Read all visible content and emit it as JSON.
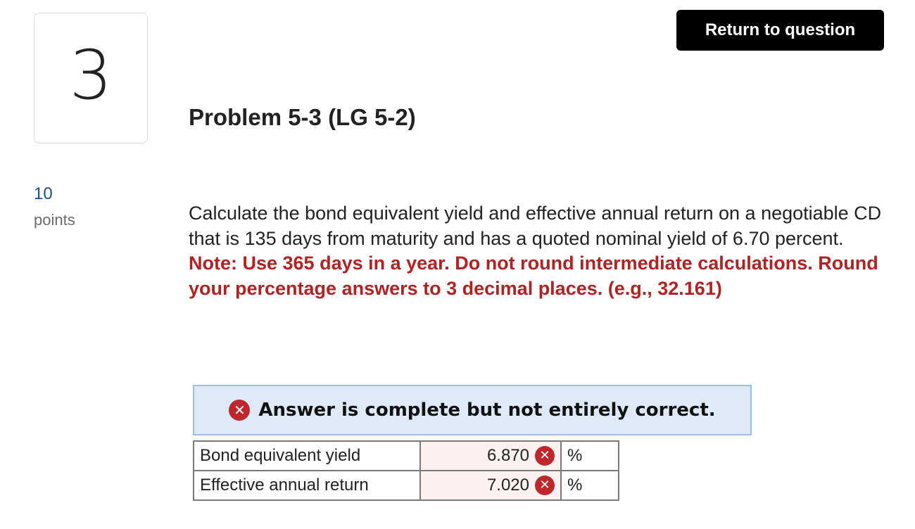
{
  "question": {
    "number": "3",
    "points_value": "10",
    "points_label": "points",
    "title": "Problem 5-3 (LG 5-2)",
    "body": "Calculate the bond equivalent yield and effective annual return on a negotiable CD that is 135 days from maturity and has a quoted nominal yield of 6.70 percent.",
    "note": "Note: Use 365 days in a year. Do not round intermediate calculations. Round your percentage answers to 3 decimal places. (e.g., 32.161)"
  },
  "header": {
    "return_label": "Return to question"
  },
  "feedback": {
    "icon": "x-circle-icon",
    "icon_glyph": "✕",
    "message": "Answer is complete but not entirely correct.",
    "status_color": "#c0272d"
  },
  "answers": [
    {
      "label": "Bond equivalent yield",
      "value": "6.870",
      "status_glyph": "✕",
      "unit": "%"
    },
    {
      "label": "Effective annual return",
      "value": "7.020",
      "status_glyph": "✕",
      "unit": "%"
    }
  ]
}
